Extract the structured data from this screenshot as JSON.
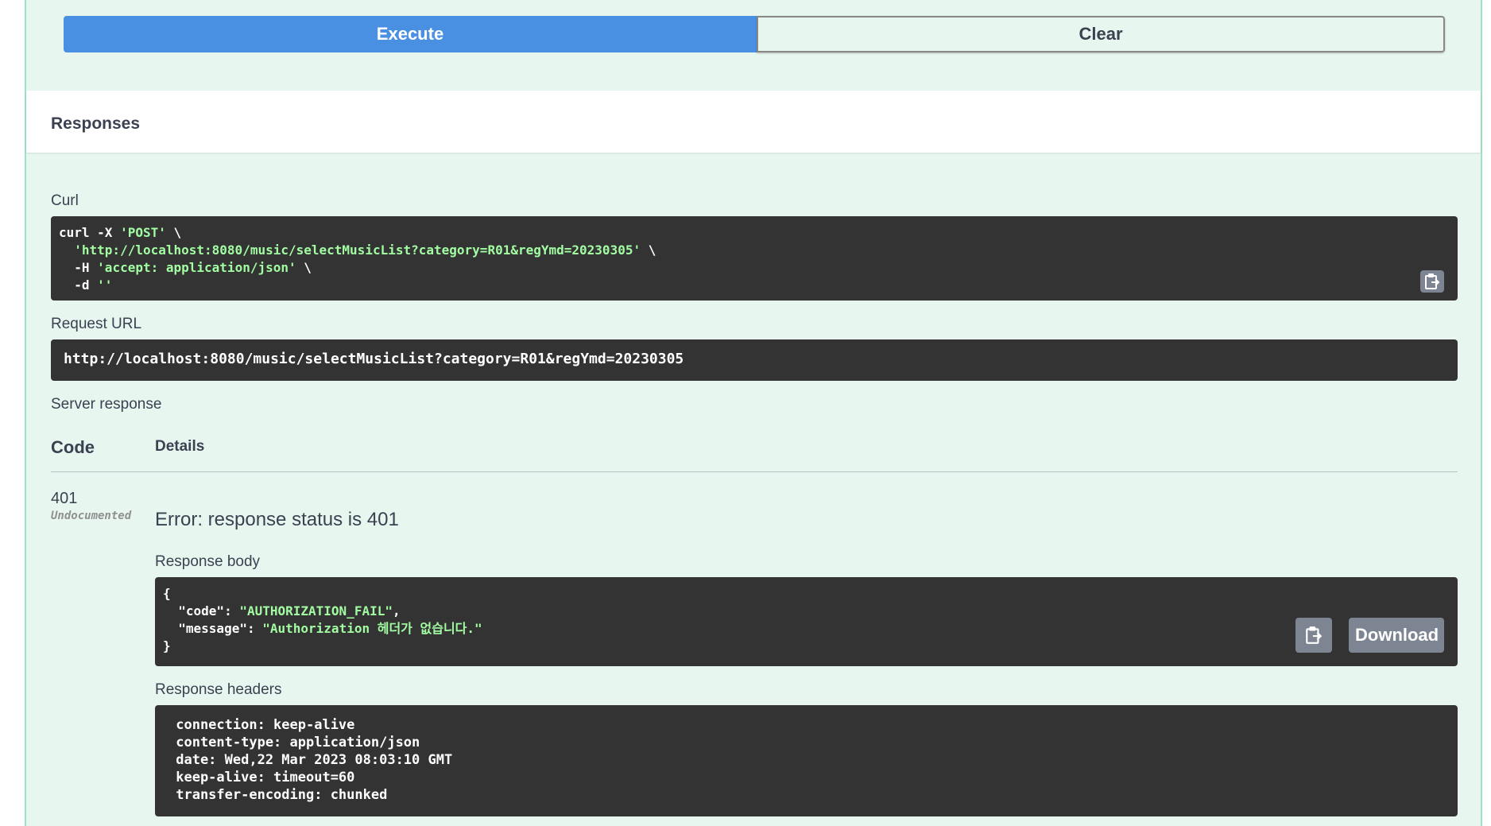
{
  "buttons": {
    "execute_label": "Execute",
    "clear_label": "Clear"
  },
  "responses": {
    "title": "Responses"
  },
  "curl": {
    "label": "Curl",
    "line1_prefix": "curl -X ",
    "line1_method": "'POST'",
    "line1_suffix": " \\",
    "line2_indent": "  ",
    "line2_url": "'http://localhost:8080/music/selectMusicList?category=R01&regYmd=20230305'",
    "line2_suffix": " \\",
    "line3_prefix": "  -H ",
    "line3_header": "'accept: application/json'",
    "line3_suffix": " \\",
    "line4_prefix": "  -d ",
    "line4_data": "''"
  },
  "request_url": {
    "label": "Request URL",
    "value": "http://localhost:8080/music/selectMusicList?category=R01&regYmd=20230305"
  },
  "server_response": {
    "label": "Server response",
    "col_code": "Code",
    "col_details": "Details",
    "code": "401",
    "code_note": "Undocumented",
    "error_text": "Error: response status is 401"
  },
  "response_body": {
    "label": "Response body",
    "open_brace": "{",
    "code_key": "  \"code\": ",
    "code_value": "\"AUTHORIZATION_FAIL\"",
    "comma": ",",
    "message_key": "  \"message\": ",
    "message_value": "\"Authorization 헤더가 없습니다.\"",
    "close_brace": "}",
    "download_label": "Download"
  },
  "response_headers": {
    "label": "Response headers",
    "lines": [
      " connection: keep-alive ",
      " content-type: application/json ",
      " date: Wed,22 Mar 2023 08:03:10 GMT ",
      " keep-alive: timeout=60 ",
      " transfer-encoding: chunked "
    ]
  },
  "icons": {
    "copy": "clipboard-icon"
  },
  "colors": {
    "execute": "#4990e2",
    "block_bg": "#e8f6f0",
    "code_bg": "#333333",
    "string": "#a2fca2"
  }
}
